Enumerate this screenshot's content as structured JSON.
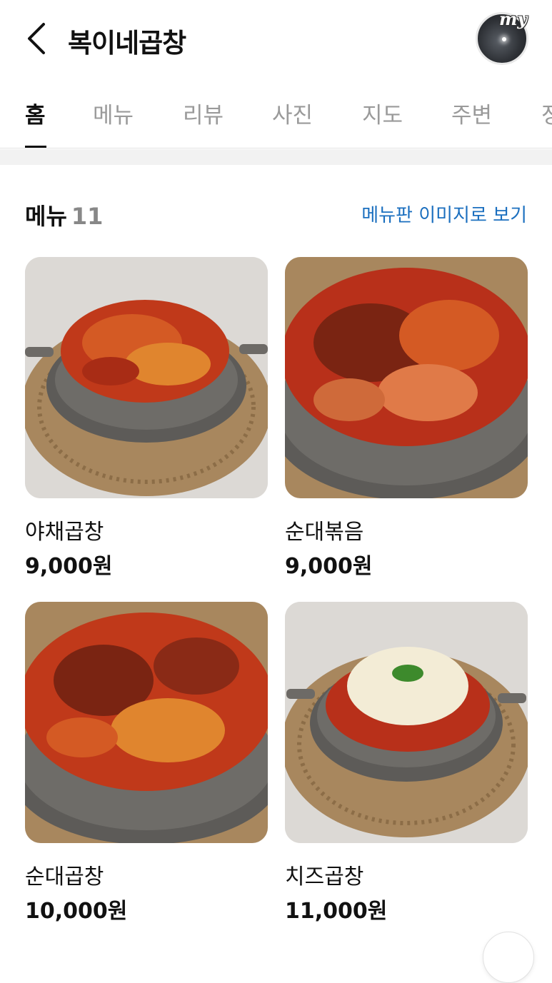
{
  "header": {
    "title": "복이네곱창",
    "avatar_text": "my"
  },
  "tabs": [
    {
      "label": "홈",
      "active": true
    },
    {
      "label": "메뉴"
    },
    {
      "label": "리뷰"
    },
    {
      "label": "사진"
    },
    {
      "label": "지도"
    },
    {
      "label": "주변"
    },
    {
      "label": "정"
    }
  ],
  "menu_section": {
    "title": "메뉴",
    "count": "11",
    "board_link": "메뉴판 이미지로 보기"
  },
  "menu_items": [
    {
      "name": "야채곱창",
      "price": "9,000원",
      "image": "stir-fried-gopchang-with-vegetables"
    },
    {
      "name": "순대볶음",
      "price": "9,000원",
      "image": "stir-fried-sundae"
    },
    {
      "name": "순대곱창",
      "price": "10,000원",
      "image": "sundae-gopchang"
    },
    {
      "name": "치즈곱창",
      "price": "11,000원",
      "image": "cheese-gopchang"
    }
  ],
  "colors": {
    "link": "#1b6fbf",
    "tab_inactive": "#9a9a9a",
    "text": "#111111"
  }
}
